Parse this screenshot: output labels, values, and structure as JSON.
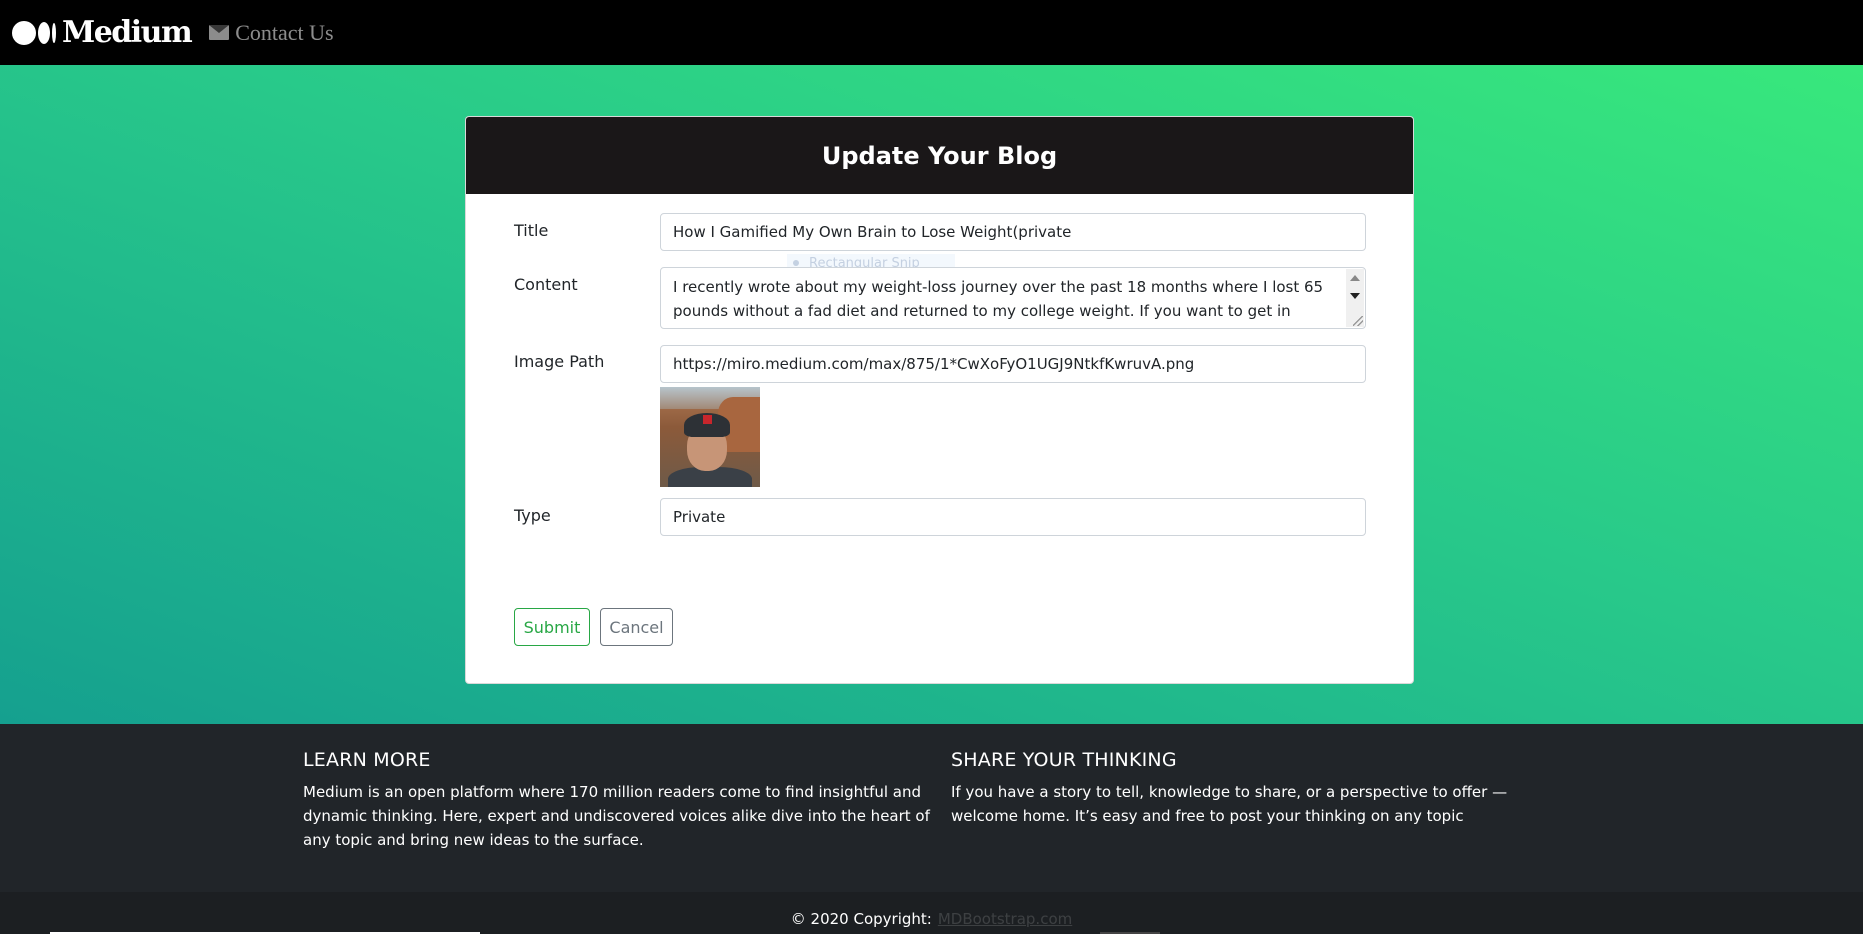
{
  "navbar": {
    "brand": "Medium",
    "contact_label": "Contact Us"
  },
  "form": {
    "heading": "Update Your Blog",
    "title_label": "Title",
    "title_value": "How I Gamified My Own Brain to Lose Weight(private",
    "content_label": "Content",
    "content_value": "I recently wrote about my weight-loss journey over the past 18 months where I lost 65 pounds without a fad diet and returned to my college weight. If you want to get in better",
    "image_label": "Image Path",
    "image_value": "https://miro.medium.com/max/875/1*CwXoFyO1UGJ9NtkfKwruvA.png",
    "type_label": "Type",
    "type_value": "Private",
    "submit_label": "Submit",
    "cancel_label": "Cancel"
  },
  "overlay": {
    "snip_text": "Rectangular Snip"
  },
  "footer": {
    "learn_heading": "LEARN MORE",
    "learn_text": "Medium is an open platform where 170 million readers come to find insightful and dynamic thinking. Here, expert and undiscovered voices alike dive into the heart of any topic and bring new ideas to the surface.",
    "share_heading": "SHARE YOUR THINKING",
    "share_text": "If you have a story to tell, knowledge to share, or a perspective to offer — welcome home. It’s easy and free to post your thinking on any topic",
    "copyright": "© 2020 Copyright:",
    "copyright_link": "MDBootstrap.com"
  },
  "colors": {
    "success": "#28a745",
    "secondary": "#6c757d",
    "footer_bg": "#212529",
    "header_bg": "#1a1718"
  },
  "icons": {
    "contact": "envelope-icon",
    "brand": "medium-logo-icon"
  }
}
